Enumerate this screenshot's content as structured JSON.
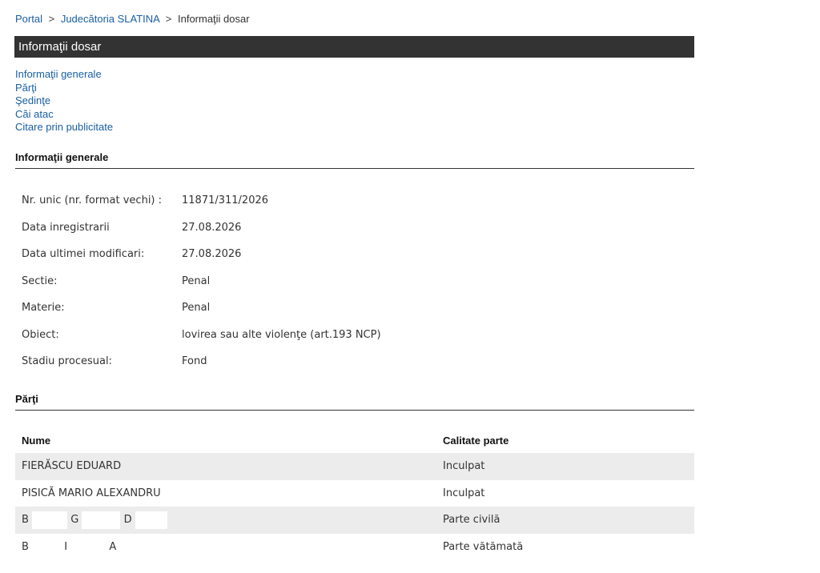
{
  "breadcrumb": {
    "portal": "Portal",
    "court": "Judecătoria SLATINA",
    "current": "Informaţii dosar",
    "separator": ">"
  },
  "title_bar": "Informaţii dosar",
  "nav_links": [
    "Informaţii generale",
    "Părţi",
    "Şedinţe",
    "Căi atac",
    "Citare prin publicitate"
  ],
  "general": {
    "heading": "Informaţii generale",
    "rows": [
      {
        "label": "Nr. unic (nr. format vechi) :",
        "value": "11871/311/2026"
      },
      {
        "label": "Data inregistrarii",
        "value": "27.08.2026"
      },
      {
        "label": "Data ultimei modificari:",
        "value": "27.08.2026"
      },
      {
        "label": "Sectie:",
        "value": "Penal"
      },
      {
        "label": "Materie:",
        "value": "Penal"
      },
      {
        "label": "Obiect:",
        "value": "lovirea sau alte violenţe (art.193 NCP)"
      },
      {
        "label": "Stadiu procesual:",
        "value": "Fond"
      }
    ]
  },
  "parties": {
    "heading": "Părţi",
    "col_name": "Nume",
    "col_role": "Calitate parte",
    "rows": [
      {
        "name": "FIERĂSCU EDUARD",
        "role": "Inculpat"
      },
      {
        "name": "PISICĂ MARIO ALEXANDRU",
        "role": "Inculpat"
      },
      {
        "name_parts": [
          "B",
          "G",
          "D"
        ],
        "role": "Parte civilă"
      },
      {
        "name_parts": [
          "B",
          "I",
          "A"
        ],
        "role": "Parte vătămată"
      }
    ]
  }
}
